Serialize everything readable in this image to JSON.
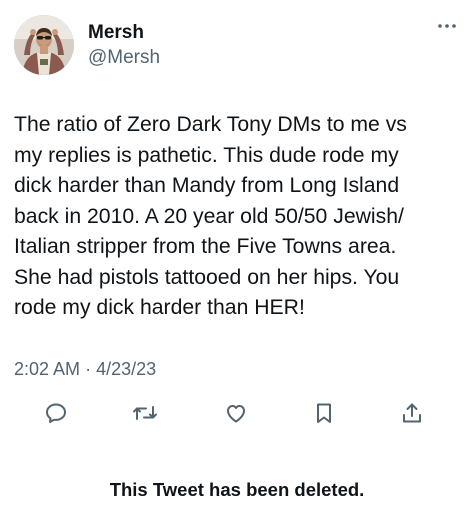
{
  "author": {
    "display_name": "Mersh",
    "handle": "@Mersh",
    "avatar_icon": "profile-photo"
  },
  "menu": {
    "icon": "more-horizontal-icon"
  },
  "tweet": {
    "lines": [
      "The ratio of Zero Dark Tony DMs to me vs",
      "my replies is pathetic. This dude rode my",
      "dick harder than Mandy from Long Island",
      "back in 2010. A 20 year old 50/50 Jewish/",
      "Italian stripper from the Five Towns area.",
      "She had pistols tattooed on her hips. You",
      "rode my dick harder than HER!"
    ],
    "time": "2:02 AM",
    "separator": "·",
    "date": "4/23/23"
  },
  "actions": [
    {
      "name": "reply",
      "icon": "reply-icon"
    },
    {
      "name": "retweet",
      "icon": "retweet-icon"
    },
    {
      "name": "like",
      "icon": "heart-icon"
    },
    {
      "name": "bookmark",
      "icon": "bookmark-icon"
    },
    {
      "name": "share",
      "icon": "share-icon"
    }
  ],
  "status": {
    "deleted_notice": "This Tweet has been deleted."
  },
  "colors": {
    "text_primary": "#0f1419",
    "text_secondary": "#536471",
    "background": "#ffffff"
  }
}
